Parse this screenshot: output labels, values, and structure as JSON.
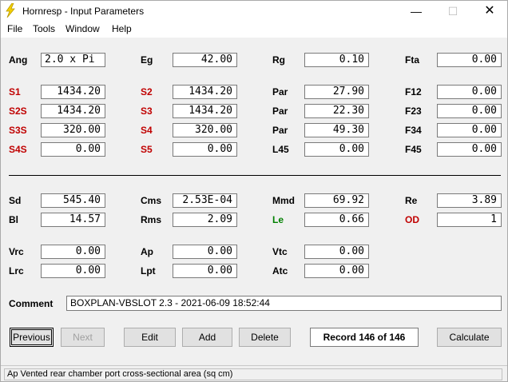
{
  "window": {
    "title": "Hornresp - Input Parameters"
  },
  "menu": {
    "file": "File",
    "tools": "Tools",
    "window": "Window",
    "help": "Help"
  },
  "fields": {
    "ang": {
      "label": "Ang",
      "value": "2.0 x Pi"
    },
    "eg": {
      "label": "Eg",
      "value": "42.00"
    },
    "rg": {
      "label": "Rg",
      "value": "0.10"
    },
    "fta": {
      "label": "Fta",
      "value": "0.00"
    },
    "s1": {
      "label": "S1",
      "value": "1434.20"
    },
    "s2": {
      "label": "S2",
      "value": "1434.20"
    },
    "par1": {
      "label": "Par",
      "value": "27.90"
    },
    "f12": {
      "label": "F12",
      "value": "0.00"
    },
    "s2s": {
      "label": "S2S",
      "value": "1434.20"
    },
    "s3": {
      "label": "S3",
      "value": "1434.20"
    },
    "par2": {
      "label": "Par",
      "value": "22.30"
    },
    "f23": {
      "label": "F23",
      "value": "0.00"
    },
    "s3s": {
      "label": "S3S",
      "value": "320.00"
    },
    "s4": {
      "label": "S4",
      "value": "320.00"
    },
    "par3": {
      "label": "Par",
      "value": "49.30"
    },
    "f34": {
      "label": "F34",
      "value": "0.00"
    },
    "s4s": {
      "label": "S4S",
      "value": "0.00"
    },
    "s5": {
      "label": "S5",
      "value": "0.00"
    },
    "l45": {
      "label": "L45",
      "value": "0.00"
    },
    "f45": {
      "label": "F45",
      "value": "0.00"
    },
    "sd": {
      "label": "Sd",
      "value": "545.40"
    },
    "cms": {
      "label": "Cms",
      "value": "2.53E-04"
    },
    "mmd": {
      "label": "Mmd",
      "value": "69.92"
    },
    "re": {
      "label": "Re",
      "value": "3.89"
    },
    "bl": {
      "label": "Bl",
      "value": "14.57"
    },
    "rms": {
      "label": "Rms",
      "value": "2.09"
    },
    "le": {
      "label": "Le",
      "value": "0.66"
    },
    "od": {
      "label": "OD",
      "value": "1"
    },
    "vrc": {
      "label": "Vrc",
      "value": "0.00"
    },
    "ap": {
      "label": "Ap",
      "value": "0.00"
    },
    "vtc": {
      "label": "Vtc",
      "value": "0.00"
    },
    "lrc": {
      "label": "Lrc",
      "value": "0.00"
    },
    "lpt": {
      "label": "Lpt",
      "value": "0.00"
    },
    "atc": {
      "label": "Atc",
      "value": "0.00"
    }
  },
  "comment": {
    "label": "Comment",
    "value": "BOXPLAN-VBSLOT 2.3 - 2021-06-09 18:52:44"
  },
  "buttons": {
    "previous": "Previous",
    "next": "Next",
    "edit": "Edit",
    "add": "Add",
    "delete": "Delete",
    "record": "Record 146 of 146",
    "calculate": "Calculate"
  },
  "status": {
    "text": "Ap   Vented rear chamber port cross-sectional area  (sq cm)"
  },
  "colors": {
    "red_label": "#c00000",
    "green_label": "#008000"
  }
}
